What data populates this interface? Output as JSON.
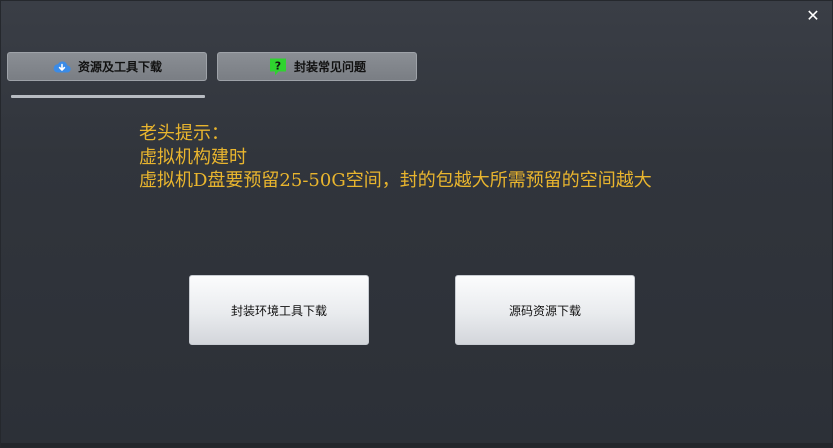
{
  "window": {
    "close_glyph": "✕"
  },
  "tabs": [
    {
      "label": "资源及工具下载",
      "icon": "cloud-icon",
      "icon_color": "#3b8be6"
    },
    {
      "label": "封装常见问题",
      "icon": "question-icon",
      "icon_color": "#2fd32f"
    }
  ],
  "notice": {
    "title": "老头提示：",
    "line1": "虚拟机构建时",
    "line2": "虚拟机D盘要预留25-50G空间，封的包越大所需预留的空间越大",
    "color": "#e9b52e"
  },
  "buttons": {
    "env_tools": "封装环境工具下载",
    "source_download": "源码资源下载"
  }
}
